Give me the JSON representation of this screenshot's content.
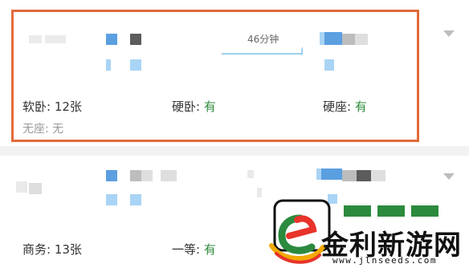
{
  "train_results": [
    {
      "duration": "46分钟",
      "seats": [
        {
          "label": "软卧: ",
          "value": "12张"
        },
        {
          "label": "硬卧: ",
          "value": "有"
        },
        {
          "label": "硬座: ",
          "value": "有"
        },
        {
          "label": "无座: ",
          "value": "无"
        }
      ]
    },
    {
      "seats": [
        {
          "label": "商务: ",
          "value": "13张"
        },
        {
          "label": "一等: ",
          "value": "有"
        }
      ]
    }
  ],
  "watermark": {
    "brand": "金利新游网",
    "url": "www.jlnseeds.com"
  },
  "colors": {
    "highlight": "#e26b3a",
    "available": "#2e8b3d",
    "muted": "#9a9a9a",
    "arrow": "#9fd0ef"
  }
}
